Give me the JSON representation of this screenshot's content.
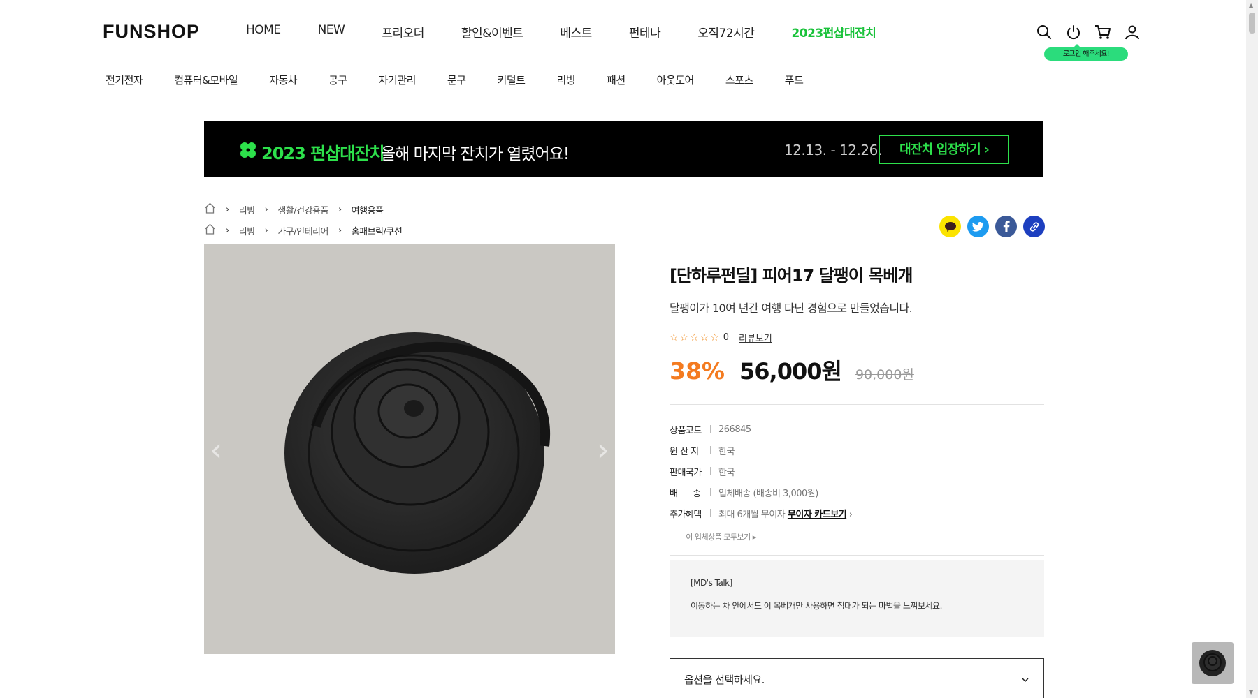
{
  "brand": {
    "logo": "FUNSHOP",
    "accent_green": "#2de04b",
    "accent_orange": "#f47b20"
  },
  "main_nav": [
    "HOME",
    "NEW",
    "프리오더",
    "할인&이벤트",
    "베스트",
    "펀테나",
    "오직72시간",
    "2023펀샵대잔치"
  ],
  "top_icons": [
    "search-icon",
    "power-icon",
    "cart-icon",
    "user-icon"
  ],
  "login_tip": "로그인 해주세요!",
  "categories": [
    "전기전자",
    "컴퓨터&모바일",
    "자동차",
    "공구",
    "자기관리",
    "문구",
    "키덜트",
    "리빙",
    "패션",
    "아웃도어",
    "스포츠",
    "푸드"
  ],
  "banner": {
    "title": "2023 펀샵대잔치",
    "subtitle": "올해 마지막 잔치가 열렸어요!",
    "date": "12.13. - 12.26.",
    "button": "대잔치 입장하기 ›"
  },
  "breadcrumbs": [
    [
      "리빙",
      "생활/건강용품",
      "여행용품"
    ],
    [
      "리빙",
      "가구/인테리어",
      "홈패브릭/쿠션"
    ]
  ],
  "share_icons": [
    "kakao-icon",
    "twitter-icon",
    "facebook-icon",
    "link-icon"
  ],
  "product": {
    "title": "[단하루펀딜] 피어17 달팽이 목베개",
    "subtitle": "달팽이가 10여 년간 여행 다닌 경험으로 만들었습니다.",
    "stars": "☆☆☆☆☆",
    "review_count": "0",
    "review_link": "리뷰보기",
    "discount": "38%",
    "price": "56,000원",
    "original_price": "90,000원",
    "specs": [
      {
        "k": "상품코드",
        "v": "266845"
      },
      {
        "k": "원 산 지",
        "v": "한국"
      },
      {
        "k": "판매국가",
        "v": "한국"
      },
      {
        "k": "배      송",
        "v": "업체배송 (배송비 3,000원)"
      },
      {
        "k": "추가혜택",
        "v": "최대 6개월 무이자",
        "link": "무이자 카드보기"
      }
    ],
    "vendor_button": "이 업체상품 모두보기 ▸",
    "md_title": "[MD's Talk]",
    "md_body": "이동하는 차 안에서도 이 목베개만 사용하면 침대가 되는 마법을 느껴보세요.",
    "option_placeholder": "옵션을 선택하세요."
  }
}
